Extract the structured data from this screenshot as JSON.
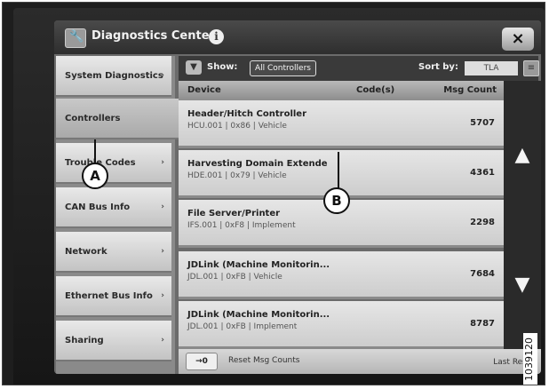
{
  "window": {
    "title": "Diagnostics Center",
    "info_icon": "i",
    "close_label": "×"
  },
  "sidebar": {
    "items": [
      {
        "label": "System Diagnostics",
        "chevron": "›"
      },
      {
        "label": "Controllers",
        "chevron": ""
      },
      {
        "label": "Trouble Codes",
        "chevron": "›"
      },
      {
        "label": "CAN Bus Info",
        "chevron": "›"
      },
      {
        "label": "Network",
        "chevron": "›"
      },
      {
        "label": "Ethernet Bus Info",
        "chevron": "›"
      },
      {
        "label": "Sharing",
        "chevron": "›"
      }
    ],
    "active_index": 1
  },
  "toolbar": {
    "show_label": "Show:",
    "show_value": "All Controllers",
    "sort_label": "Sort by:",
    "sort_value": "TLA"
  },
  "table": {
    "columns": [
      "Device",
      "Code(s)",
      "Msg Count"
    ],
    "rows": [
      {
        "device": "Header/Hitch Controller",
        "sub": "HCU.001 | 0x86 | Vehicle",
        "count": "5707"
      },
      {
        "device": "Harvesting Domain Extende",
        "sub": "HDE.001 | 0x79 | Vehicle",
        "count": "4361"
      },
      {
        "device": "File Server/Printer",
        "sub": "IFS.001 | 0xF8 | Implement",
        "count": "2298"
      },
      {
        "device": "JDLink (Machine Monitorin...",
        "sub": "JDL.001 | 0xFB | Vehicle",
        "count": "7684"
      },
      {
        "device": "JDLink (Machine Monitorin...",
        "sub": "JDL.001 | 0xFB | Implement",
        "count": "8787"
      }
    ]
  },
  "scroll": {
    "up": "▲",
    "down": "▼"
  },
  "bottom": {
    "reset_button": "→0",
    "reset_label": "Reset Msg Counts",
    "last_reset": "Last Reset:"
  },
  "callouts": {
    "a": "A",
    "b": "B"
  },
  "figure_number": "1039120"
}
